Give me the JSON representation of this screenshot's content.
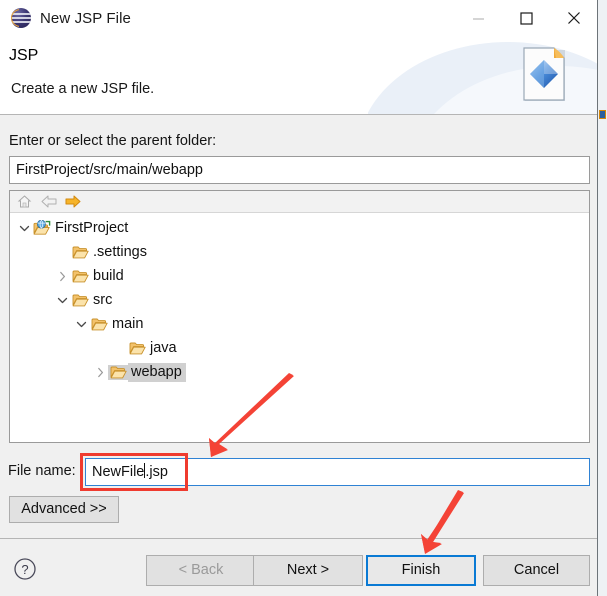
{
  "window": {
    "title": "New JSP File",
    "icon": "eclipse-logo-icon",
    "controls": {
      "minimize": "minimize-icon",
      "maximize": "maximize-icon",
      "close": "close-icon"
    }
  },
  "header": {
    "title": "JSP",
    "description": "Create a new JSP file.",
    "banner_icon": "jsp-file-icon"
  },
  "parent_folder": {
    "label": "Enter or select the parent folder:",
    "value": "FirstProject/src/main/webapp"
  },
  "tree": {
    "toolbar": [
      {
        "name": "home-icon",
        "enabled": false
      },
      {
        "name": "back-arrow-icon",
        "enabled": false
      },
      {
        "name": "forward-arrow-icon",
        "enabled": true
      }
    ],
    "nodes": [
      {
        "label": "FirstProject",
        "indent": 0,
        "twisty": "expanded",
        "icon": "project-folder-icon",
        "selected": false
      },
      {
        "label": ".settings",
        "indent": 2,
        "twisty": "none",
        "icon": "folder-icon",
        "selected": false
      },
      {
        "label": "build",
        "indent": 2,
        "twisty": "collapsed",
        "icon": "folder-icon",
        "selected": false
      },
      {
        "label": "src",
        "indent": 2,
        "twisty": "expanded",
        "icon": "folder-icon",
        "selected": false
      },
      {
        "label": "main",
        "indent": 3,
        "twisty": "expanded",
        "icon": "folder-icon",
        "selected": false
      },
      {
        "label": "java",
        "indent": 5,
        "twisty": "none",
        "icon": "folder-icon",
        "selected": false
      },
      {
        "label": "webapp",
        "indent": 4,
        "twisty": "collapsed",
        "icon": "folder-icon",
        "selected": true
      }
    ]
  },
  "file_name": {
    "label": "File name:",
    "value_before_caret": "NewFile",
    "value_after_caret": ".jsp",
    "full_value": "NewFile.jsp"
  },
  "advanced": {
    "label": "Advanced >>"
  },
  "footer": {
    "help_icon": "help-question-icon",
    "buttons": [
      {
        "label": "< Back",
        "enabled": false,
        "focused": false
      },
      {
        "label": "Next >",
        "enabled": true,
        "focused": false
      },
      {
        "label": "Finish",
        "enabled": true,
        "focused": true
      },
      {
        "label": "Cancel",
        "enabled": true,
        "focused": false
      }
    ]
  },
  "annotations": {
    "highlight_color": "#ef3b2f",
    "box_target": "file-name-input",
    "arrow_1_target": "file-name-input",
    "arrow_2_target": "finish-button"
  },
  "colors": {
    "accent_blue": "#0a7ad4",
    "folder_orange": "#e8a33d",
    "annotation_red": "#ef3b2f",
    "dialog_bg": "#f0f0f0",
    "field_bg": "#ffffff"
  }
}
